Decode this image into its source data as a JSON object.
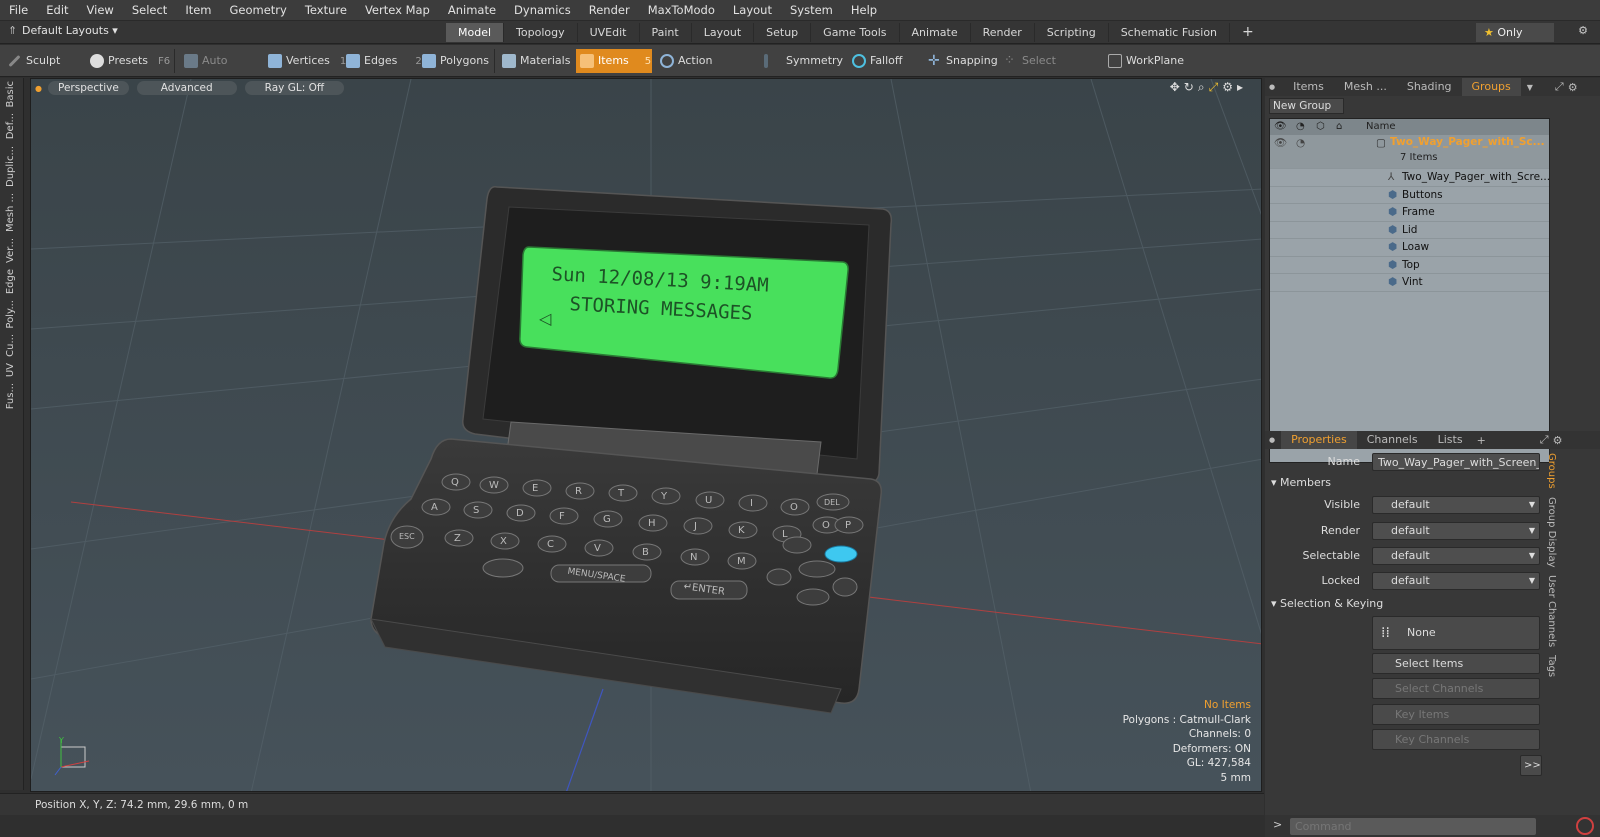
{
  "menu": [
    "File",
    "Edit",
    "View",
    "Select",
    "Item",
    "Geometry",
    "Texture",
    "Vertex Map",
    "Animate",
    "Dynamics",
    "Render",
    "MaxToModo",
    "Layout",
    "System",
    "Help"
  ],
  "layouts_label": "Default Layouts ▾",
  "mode_tabs": [
    "Model",
    "Topology",
    "UVEdit",
    "Paint",
    "Layout",
    "Setup",
    "Game Tools",
    "Animate",
    "Render",
    "Scripting",
    "Schematic Fusion"
  ],
  "active_mode": "Model",
  "only_label": "Only",
  "toolbar": {
    "sculpt": "Sculpt",
    "presets": "Presets",
    "presets_key": "F6",
    "auto_select": "Auto Select",
    "vertices": "Vertices",
    "vertices_key": "1",
    "edges": "Edges",
    "edges_key": "2",
    "polygons": "Polygons",
    "materials": "Materials",
    "items": "Items",
    "items_key": "5",
    "action_center": "Action Center",
    "symmetry": "Symmetry",
    "falloff": "Falloff",
    "snapping": "Snapping",
    "select_through": "Select Through",
    "workplane": "WorkPlane"
  },
  "left_tabs": [
    "Basic",
    "Def...",
    "Duplic...",
    "Mesh ...",
    "Ver...",
    "Edge",
    "Poly...",
    "Cu...",
    "UV",
    "Fus..."
  ],
  "viewport": {
    "perspective": "Perspective",
    "advanced": "Advanced",
    "raygl": "Ray GL: Off",
    "screen_line1": "Sun 12/08/13  9:19AM",
    "screen_line2": "STORING MESSAGES",
    "info": {
      "no_items": "No Items",
      "polygons": "Polygons : Catmull-Clark",
      "channels": "Channels: 0",
      "deformers": "Deformers: ON",
      "gl": "GL: 427,584",
      "scale": "5 mm"
    }
  },
  "status": "Position X, Y, Z:   74.2 mm, 29.6 mm, 0 m",
  "panel_tabs": [
    "Items",
    "Mesh ...",
    "Shading",
    "Groups"
  ],
  "active_panel_tab": "Groups",
  "new_group": "New Group",
  "outliner": {
    "name_header": "Name",
    "group_name": "Two_Way_Pager_with_Sc...",
    "group_count": "7 Items",
    "children": [
      "Two_Way_Pager_with_Scre...",
      "Buttons",
      "Frame",
      "Lid",
      "Loaw",
      "Top",
      "Vint"
    ]
  },
  "props_tabs": [
    "Properties",
    "Channels",
    "Lists"
  ],
  "properties": {
    "name_label": "Name",
    "name_value": "Two_Way_Pager_with_Screen_O",
    "members": "Members",
    "visible_label": "Visible",
    "visible": "default",
    "render_label": "Render",
    "render": "default",
    "selectable_label": "Selectable",
    "selectable": "default",
    "locked_label": "Locked",
    "locked": "default",
    "selection_keying": "Selection & Keying",
    "none": "None",
    "select_items": "Select Items",
    "select_channels": "Select Channels",
    "key_items": "Key Items",
    "key_channels": "Key Channels",
    "more": ">>"
  },
  "vertical_tabs": [
    "Groups",
    "Group Display",
    "User Channels",
    "Tags"
  ],
  "command_placeholder": "Command"
}
